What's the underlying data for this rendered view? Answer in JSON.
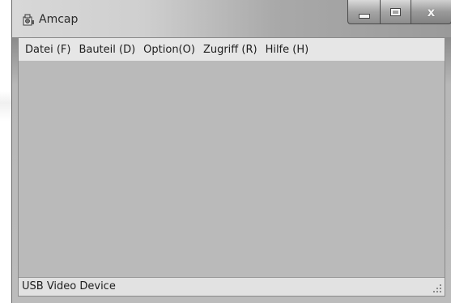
{
  "window": {
    "title": "Amcap",
    "app_icon": "amcap-camera-icon",
    "controls": {
      "minimize_icon": "minimize-icon",
      "maximize_icon": "maximize-icon",
      "close_icon": "close-icon",
      "close_glyph": "x"
    }
  },
  "menubar": {
    "items": [
      {
        "label": "Datei (F)"
      },
      {
        "label": "Bauteil (D)"
      },
      {
        "label": "Option(O)"
      },
      {
        "label": "Zugriff (R)"
      },
      {
        "label": "Hilfe (H)"
      }
    ]
  },
  "statusbar": {
    "text": "USB Video Device",
    "grip_icon": "resize-grip-icon"
  },
  "colors": {
    "content_background": "#bababa",
    "menubar_background": "#e6e6e6",
    "statusbar_background": "#e2e2e2"
  }
}
